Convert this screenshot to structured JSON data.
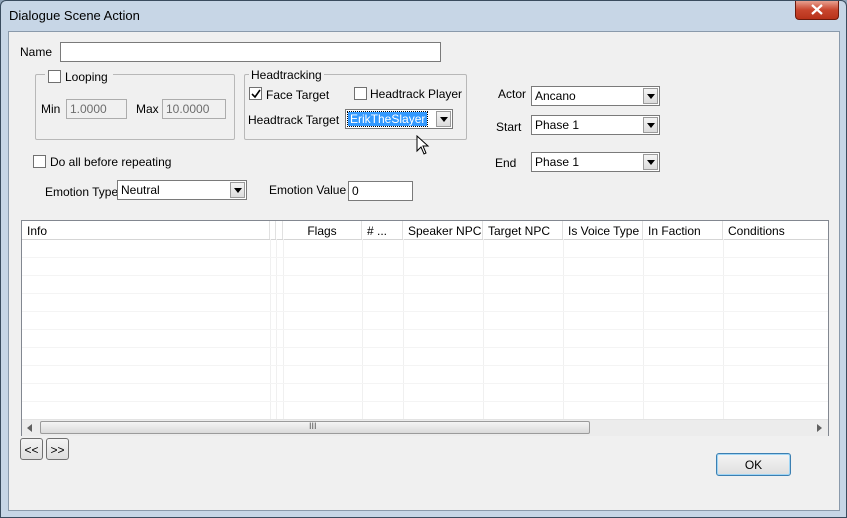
{
  "window": {
    "title": "Dialogue Scene Action"
  },
  "name": {
    "label": "Name",
    "value": ""
  },
  "looping": {
    "label": "Looping",
    "checked": false,
    "min_label": "Min",
    "min_value": "1.0000",
    "max_label": "Max",
    "max_value": "10.0000"
  },
  "headtracking": {
    "label": "Headtracking",
    "face_target_label": "Face Target",
    "face_target_checked": true,
    "headtrack_player_label": "Headtrack Player",
    "headtrack_player_checked": false,
    "target_label": "Headtrack Target",
    "target_value": "ErikTheSlayer"
  },
  "actor": {
    "label": "Actor",
    "value": "Ancano"
  },
  "start": {
    "label": "Start",
    "value": "Phase 1"
  },
  "end": {
    "label": "End",
    "value": "Phase 1"
  },
  "do_all": {
    "label": "Do all before repeating",
    "checked": false
  },
  "emotion_type": {
    "label": "Emotion Type",
    "value": "Neutral"
  },
  "emotion_value": {
    "label": "Emotion Value",
    "value": "0"
  },
  "list": {
    "columns": [
      "Info",
      "Flags",
      "# ...",
      "Speaker NPC",
      "Target NPC",
      "Is Voice Type",
      "In Faction",
      "Conditions"
    ],
    "scroll_thumb_glyph": "III"
  },
  "nav": {
    "prev": "<<",
    "next": ">>"
  },
  "ok_button": "OK",
  "colors": {
    "selection": "#3399ff",
    "client_bg": "#f0f0f0",
    "frame": "#c7d6e6"
  }
}
